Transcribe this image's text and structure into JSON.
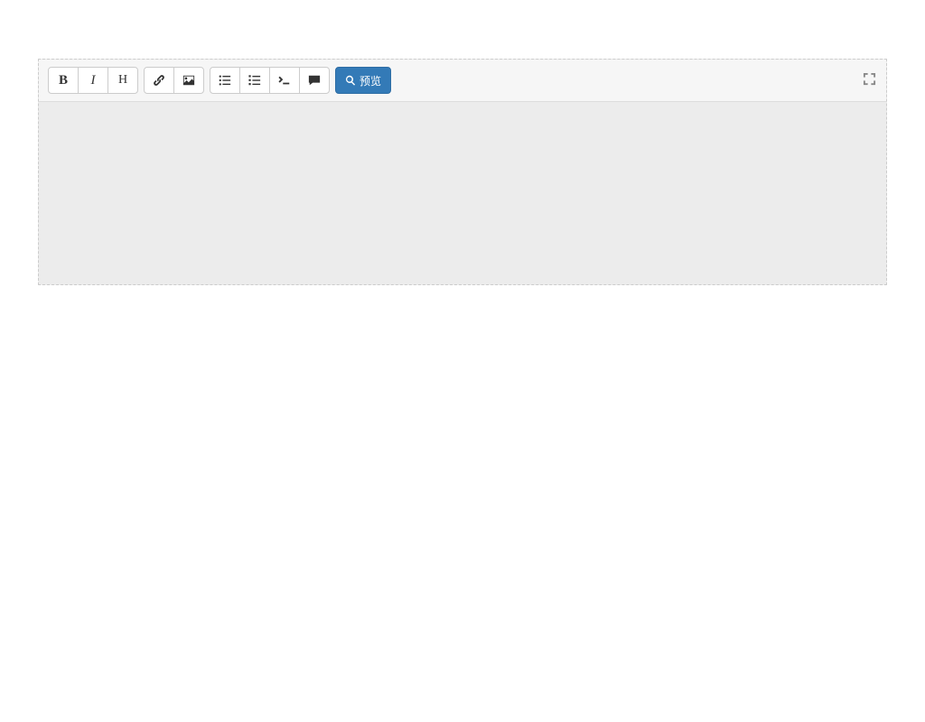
{
  "toolbar": {
    "bold": "B",
    "italic": "I",
    "heading": "H",
    "preview_label": "预览"
  }
}
